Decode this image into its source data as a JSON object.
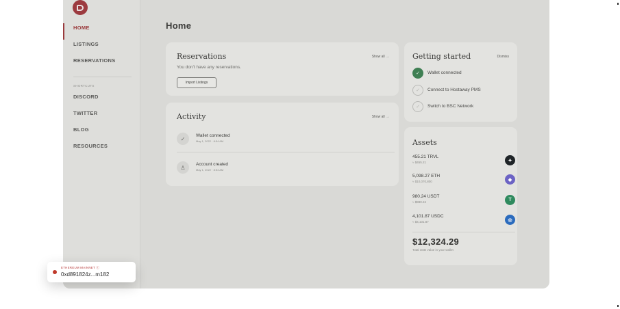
{
  "sidebar": {
    "logo_letter": "D",
    "nav": [
      {
        "label": "HOME",
        "active": true
      },
      {
        "label": "LISTINGS",
        "active": false
      },
      {
        "label": "RESERVATIONS",
        "active": false
      }
    ],
    "section_label": "SHORTCUTS",
    "shortcuts": [
      "DISCORD",
      "TWITTER",
      "BLOG",
      "RESOURCES"
    ]
  },
  "main": {
    "title": "Home",
    "reservations": {
      "title": "Reservations",
      "show_all": "Show all →",
      "empty_text": "You don't have any reservations.",
      "import_button": "Import Listings"
    },
    "activity": {
      "title": "Activity",
      "show_all": "Show all →",
      "items": [
        {
          "icon": "check-icon",
          "title": "Wallet connected",
          "time": "May 1, 2022 · 8:54 AM"
        },
        {
          "icon": "user-icon",
          "title": "Account created",
          "time": "May 1, 2022 · 8:54 AM"
        }
      ]
    },
    "getting_started": {
      "title": "Getting started",
      "dismiss": "Dismiss",
      "steps": [
        {
          "label": "Wallet connected",
          "done": true
        },
        {
          "label": "Connect to Hostaway PMS",
          "done": false
        },
        {
          "label": "Switch to BSC Network",
          "done": false
        }
      ]
    },
    "assets": {
      "title": "Assets",
      "items": [
        {
          "amount": "455.21 TRVL",
          "usd": "≈ $455.21",
          "icon": "trvl-icon",
          "color": "#1f2427"
        },
        {
          "amount": "5,098.27 ETH",
          "usd": "≈ $10,070,800",
          "icon": "eth-icon",
          "color": "#6c63c4"
        },
        {
          "amount": "980.24 USDT",
          "usd": "≈ $980.24",
          "icon": "usdt-icon",
          "color": "#2f8a5e"
        },
        {
          "amount": "4,101.87 USDC",
          "usd": "≈ $4,101.87",
          "icon": "usdc-icon",
          "color": "#2b6bbd"
        }
      ],
      "total": "$12,324.29",
      "total_label": "Total USD value in your wallet"
    }
  },
  "network": {
    "name": "ETHEREUM MAINNET ⓘ",
    "address": "0xd891824z...m182",
    "status_color": "#c0392b"
  }
}
